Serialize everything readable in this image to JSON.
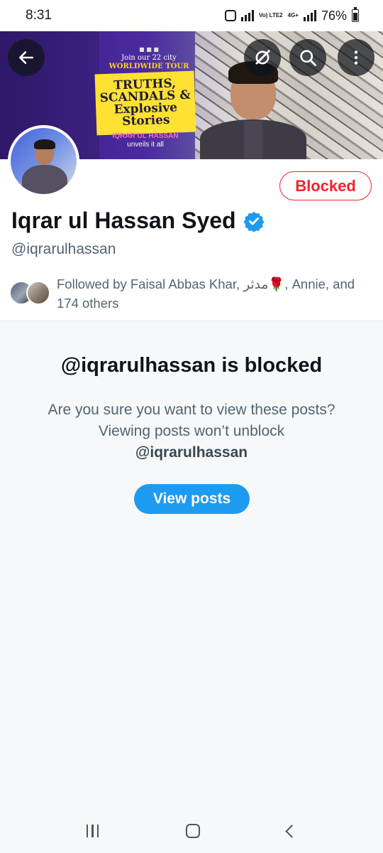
{
  "status_bar": {
    "time": "8:31",
    "network_1": "Vo) LTE2",
    "network_2": "4G+",
    "battery": "76%",
    "battery_level": 0.76
  },
  "banner": {
    "tour_line": "Join our 22 city",
    "tour_highlight": "WORLDWIDE TOUR",
    "headline": "TRUTHS, SCANDALS & Explosive Stories",
    "byline_name": "IQRAR UL HASSAN",
    "byline_text": "unveils it all"
  },
  "toolbar": {
    "back_icon": "arrow-left-icon",
    "grok_icon": "grok-icon",
    "search_icon": "search-icon",
    "more_icon": "more-vertical-icon"
  },
  "profile": {
    "name": "Iqrar ul Hassan Syed",
    "handle": "@iqrarulhassan",
    "verified": true,
    "blocked_label": "Blocked",
    "followed_by": "Followed by Faisal Abbas Khar, مدثر🌹, Annie, and 174 others"
  },
  "blocked_notice": {
    "title": "@iqrarulhassan is blocked",
    "description": "Are you sure you want to view these posts? Viewing posts won’t unblock",
    "handle": "@iqrarulhassan",
    "button_label": "View posts"
  },
  "colors": {
    "accent": "#1d9bf0",
    "blocked": "#f4212e",
    "secondary_text": "#536471"
  }
}
